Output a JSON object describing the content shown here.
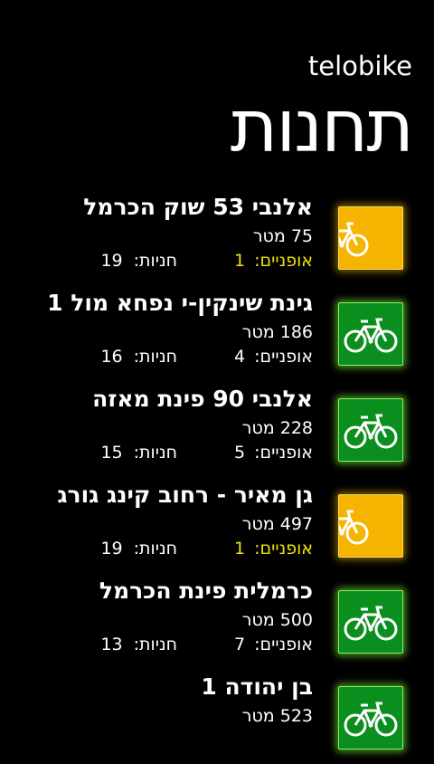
{
  "app": {
    "title": "telobike",
    "page_title": "תחנות"
  },
  "labels": {
    "bikes": "אופניים:",
    "docks": "חניות:"
  },
  "colors": {
    "available": "#0a8f1e",
    "low": "#f5b400",
    "low_text": "#f4e200"
  },
  "stations": [
    {
      "name": "אלנבי 53 שוק הכרמל",
      "distance": "75 מטר",
      "bikes": "1",
      "docks": "19",
      "status": "low",
      "icon": "bicycle-icon"
    },
    {
      "name": "גינת שינקין-י נפחא מול 1",
      "distance": "186 מטר",
      "bikes": "4",
      "docks": "16",
      "status": "available",
      "icon": "bicycle-icon"
    },
    {
      "name": "אלנבי 90 פינת מאזה",
      "distance": "228 מטר",
      "bikes": "5",
      "docks": "15",
      "status": "available",
      "icon": "bicycle-icon"
    },
    {
      "name": "גן מאיר - רחוב קינג גורג",
      "distance": "497 מטר",
      "bikes": "1",
      "docks": "19",
      "status": "low",
      "icon": "bicycle-icon"
    },
    {
      "name": "כרמלית פינת הכרמל",
      "distance": "500 מטר",
      "bikes": "7",
      "docks": "13",
      "status": "available",
      "icon": "bicycle-icon"
    },
    {
      "name": "בן יהודה 1",
      "distance": "523 מטר",
      "bikes": "",
      "docks": "",
      "status": "available",
      "icon": "bicycle-icon"
    }
  ]
}
